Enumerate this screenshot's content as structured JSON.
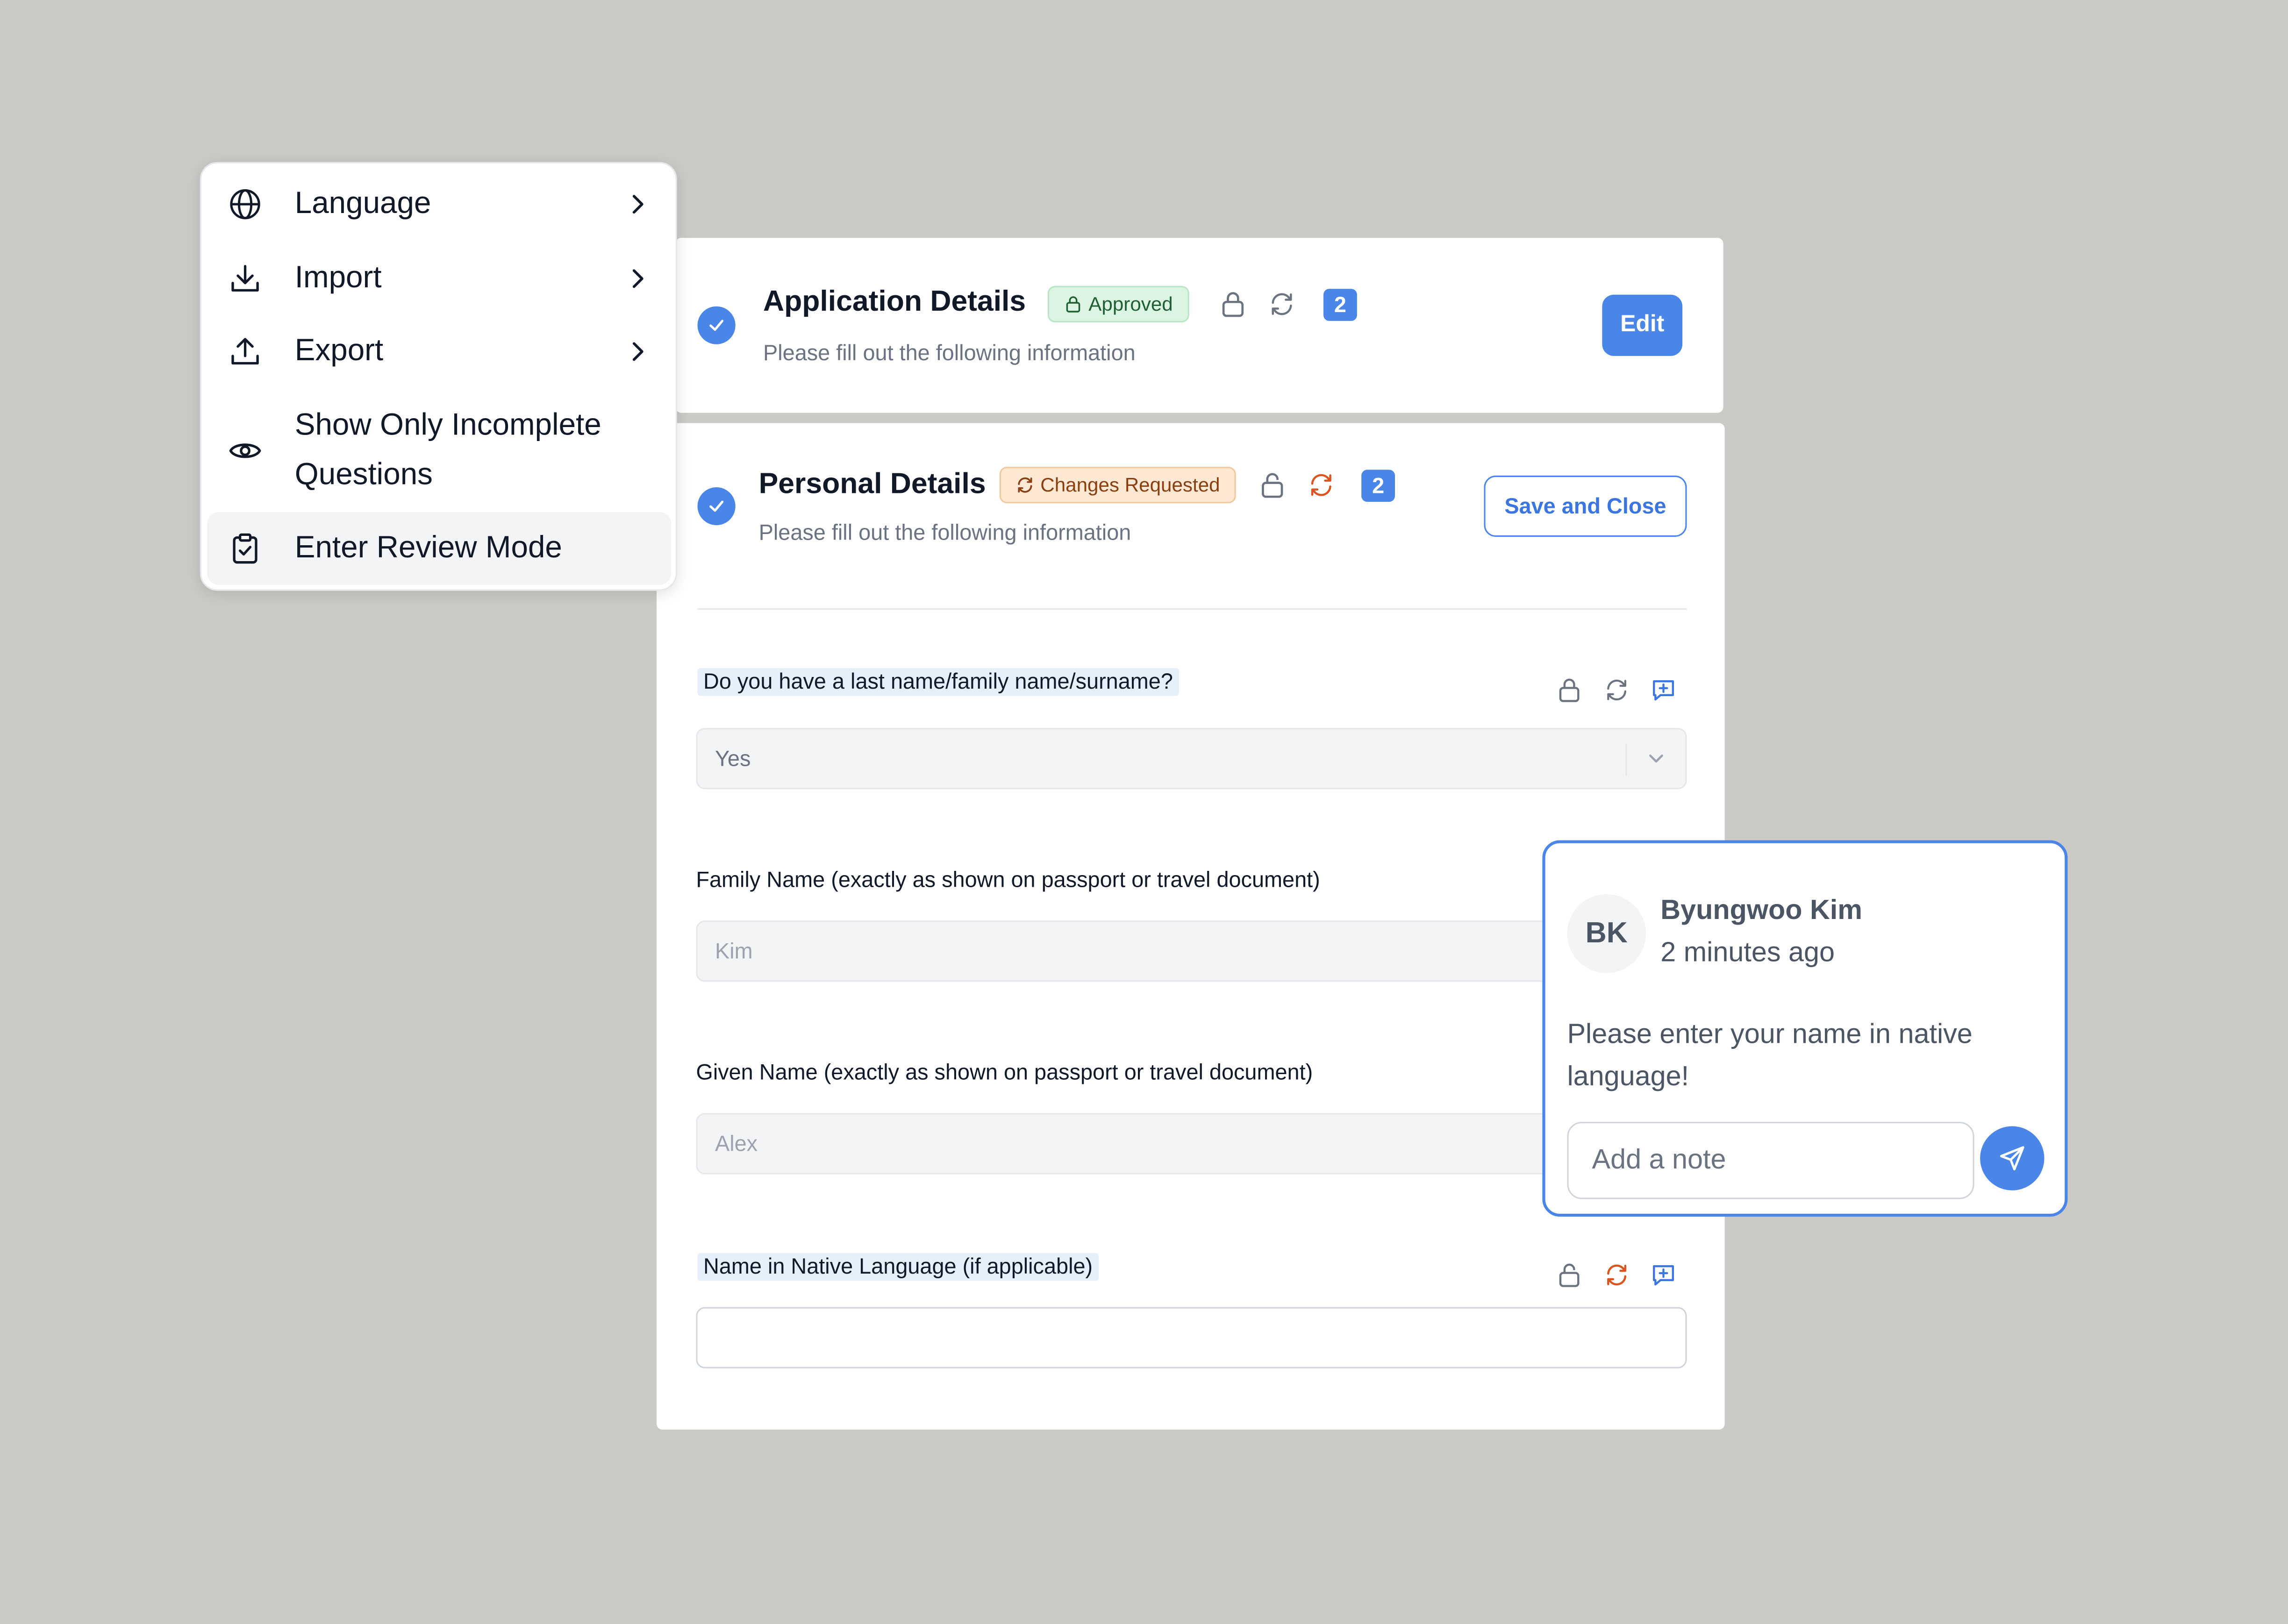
{
  "menu": {
    "items": [
      {
        "label": "Language",
        "icon": "globe-icon",
        "has_submenu": true
      },
      {
        "label": "Import",
        "icon": "download-icon",
        "has_submenu": true
      },
      {
        "label": "Export",
        "icon": "upload-icon",
        "has_submenu": true
      },
      {
        "label_line1": "Show Only Incomplete",
        "label_line2": "Questions",
        "icon": "eye-icon",
        "has_submenu": false
      },
      {
        "label": "Enter Review Mode",
        "icon": "clipboard-check-icon",
        "has_submenu": false,
        "active": true
      }
    ]
  },
  "application_section": {
    "title": "Application Details",
    "status": "Approved",
    "subtitle": "Please fill out the following information",
    "count": "2",
    "edit_label": "Edit"
  },
  "personal_section": {
    "title": "Personal Details",
    "status": "Changes Requested",
    "subtitle": "Please fill out the following information",
    "count": "2",
    "save_label": "Save and Close"
  },
  "questions": [
    {
      "label": "Do you have a last name/family name/surname?",
      "value": "Yes"
    },
    {
      "label": "Family Name (exactly as shown on passport or travel document)",
      "placeholder": "Kim"
    },
    {
      "label": "Given Name (exactly as shown on passport or travel document)",
      "placeholder": "Alex"
    },
    {
      "label": "Name in Native Language (if applicable)",
      "value": ""
    }
  ],
  "comment": {
    "initials": "BK",
    "author": "Byungwoo Kim",
    "time": "2 minutes ago",
    "body": "Please enter your name in native language!",
    "input_placeholder": "Add a note"
  },
  "colors": {
    "accent": "#4a86e8",
    "approved_bg": "#dcf5e3",
    "changes_bg": "#fde8d3",
    "changes_icon": "#d9551f",
    "background": "#cbcac6"
  }
}
